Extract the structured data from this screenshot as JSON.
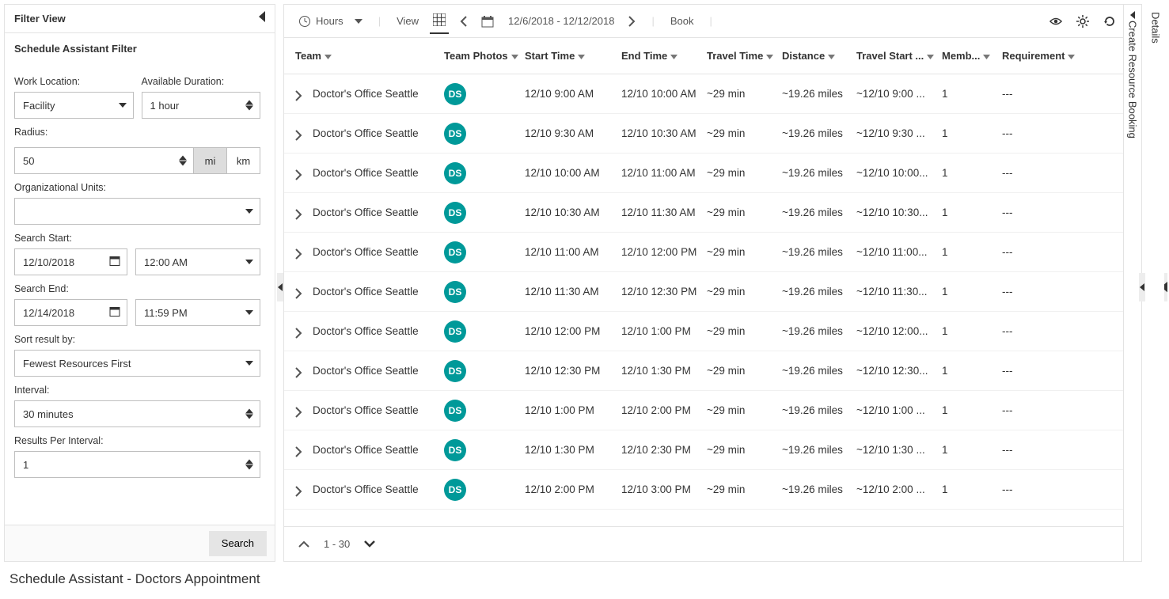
{
  "filter": {
    "panel_title": "Filter View",
    "subtitle": "Schedule Assistant Filter",
    "work_location_label": "Work Location:",
    "work_location_value": "Facility",
    "avail_duration_label": "Available Duration:",
    "avail_duration_value": "1 hour",
    "radius_label": "Radius:",
    "radius_value": "50",
    "unit_mi": "mi",
    "unit_km": "km",
    "org_units_label": "Organizational Units:",
    "org_units_value": "",
    "search_start_label": "Search Start:",
    "search_start_date": "12/10/2018",
    "search_start_time": "12:00 AM",
    "search_end_label": "Search End:",
    "search_end_date": "12/14/2018",
    "search_end_time": "11:59 PM",
    "sort_label": "Sort result by:",
    "sort_value": "Fewest Resources First",
    "interval_label": "Interval:",
    "interval_value": "30 minutes",
    "rpi_label": "Results Per Interval:",
    "rpi_value": "1",
    "search_button": "Search"
  },
  "toolbar": {
    "hours": "Hours",
    "view": "View",
    "date_range": "12/6/2018 - 12/12/2018",
    "book": "Book"
  },
  "columns": {
    "team": "Team",
    "photos": "Team Photos",
    "start": "Start Time",
    "end": "End Time",
    "travel": "Travel Time",
    "distance": "Distance",
    "tstart": "Travel Start ...",
    "members": "Memb...",
    "requirement": "Requirement"
  },
  "rows": [
    {
      "team": "Doctor's Office Seattle",
      "badge": "DS",
      "start": "12/10 9:00 AM",
      "end": "12/10 10:00 AM",
      "travel": "~29 min",
      "dist": "~19.26 miles",
      "tstart": "~12/10 9:00 ...",
      "members": "1",
      "req": "---"
    },
    {
      "team": "Doctor's Office Seattle",
      "badge": "DS",
      "start": "12/10 9:30 AM",
      "end": "12/10 10:30 AM",
      "travel": "~29 min",
      "dist": "~19.26 miles",
      "tstart": "~12/10 9:30 ...",
      "members": "1",
      "req": "---"
    },
    {
      "team": "Doctor's Office Seattle",
      "badge": "DS",
      "start": "12/10 10:00 AM",
      "end": "12/10 11:00 AM",
      "travel": "~29 min",
      "dist": "~19.26 miles",
      "tstart": "~12/10 10:00...",
      "members": "1",
      "req": "---"
    },
    {
      "team": "Doctor's Office Seattle",
      "badge": "DS",
      "start": "12/10 10:30 AM",
      "end": "12/10 11:30 AM",
      "travel": "~29 min",
      "dist": "~19.26 miles",
      "tstart": "~12/10 10:30...",
      "members": "1",
      "req": "---"
    },
    {
      "team": "Doctor's Office Seattle",
      "badge": "DS",
      "start": "12/10 11:00 AM",
      "end": "12/10 12:00 PM",
      "travel": "~29 min",
      "dist": "~19.26 miles",
      "tstart": "~12/10 11:00...",
      "members": "1",
      "req": "---"
    },
    {
      "team": "Doctor's Office Seattle",
      "badge": "DS",
      "start": "12/10 11:30 AM",
      "end": "12/10 12:30 PM",
      "travel": "~29 min",
      "dist": "~19.26 miles",
      "tstart": "~12/10 11:30...",
      "members": "1",
      "req": "---"
    },
    {
      "team": "Doctor's Office Seattle",
      "badge": "DS",
      "start": "12/10 12:00 PM",
      "end": "12/10 1:00 PM",
      "travel": "~29 min",
      "dist": "~19.26 miles",
      "tstart": "~12/10 12:00...",
      "members": "1",
      "req": "---"
    },
    {
      "team": "Doctor's Office Seattle",
      "badge": "DS",
      "start": "12/10 12:30 PM",
      "end": "12/10 1:30 PM",
      "travel": "~29 min",
      "dist": "~19.26 miles",
      "tstart": "~12/10 12:30...",
      "members": "1",
      "req": "---"
    },
    {
      "team": "Doctor's Office Seattle",
      "badge": "DS",
      "start": "12/10 1:00 PM",
      "end": "12/10 2:00 PM",
      "travel": "~29 min",
      "dist": "~19.26 miles",
      "tstart": "~12/10 1:00 ...",
      "members": "1",
      "req": "---"
    },
    {
      "team": "Doctor's Office Seattle",
      "badge": "DS",
      "start": "12/10 1:30 PM",
      "end": "12/10 2:30 PM",
      "travel": "~29 min",
      "dist": "~19.26 miles",
      "tstart": "~12/10 1:30 ...",
      "members": "1",
      "req": "---"
    },
    {
      "team": "Doctor's Office Seattle",
      "badge": "DS",
      "start": "12/10 2:00 PM",
      "end": "12/10 3:00 PM",
      "travel": "~29 min",
      "dist": "~19.26 miles",
      "tstart": "~12/10 2:00 ...",
      "members": "1",
      "req": "---"
    }
  ],
  "footer": {
    "page_range": "1 - 30"
  },
  "right": {
    "create_booking": "Create Resource Booking",
    "details": "Details"
  },
  "page_title": "Schedule Assistant - Doctors Appointment"
}
